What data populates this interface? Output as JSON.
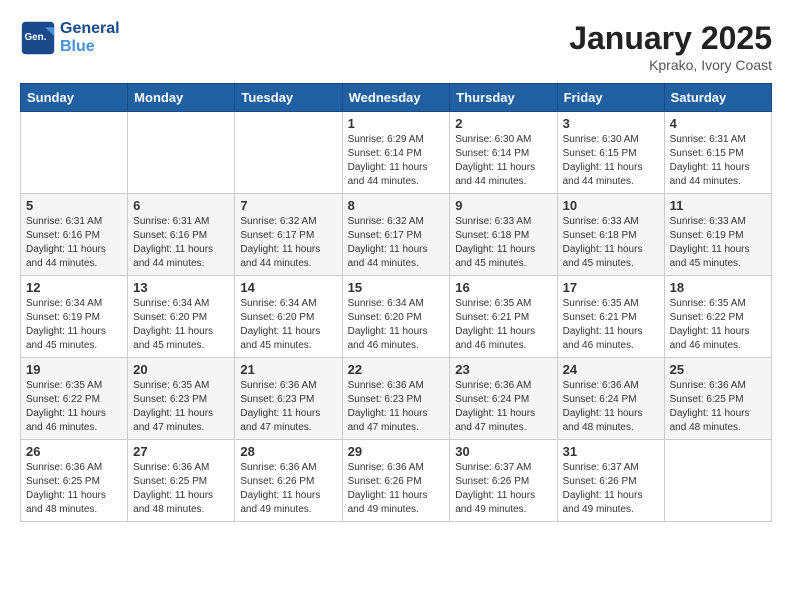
{
  "header": {
    "logo_line1": "General",
    "logo_line2": "Blue",
    "month": "January 2025",
    "location": "Kprako, Ivory Coast"
  },
  "weekdays": [
    "Sunday",
    "Monday",
    "Tuesday",
    "Wednesday",
    "Thursday",
    "Friday",
    "Saturday"
  ],
  "weeks": [
    [
      {
        "day": "",
        "sunrise": "",
        "sunset": "",
        "daylight": ""
      },
      {
        "day": "",
        "sunrise": "",
        "sunset": "",
        "daylight": ""
      },
      {
        "day": "",
        "sunrise": "",
        "sunset": "",
        "daylight": ""
      },
      {
        "day": "1",
        "sunrise": "Sunrise: 6:29 AM",
        "sunset": "Sunset: 6:14 PM",
        "daylight": "Daylight: 11 hours and 44 minutes."
      },
      {
        "day": "2",
        "sunrise": "Sunrise: 6:30 AM",
        "sunset": "Sunset: 6:14 PM",
        "daylight": "Daylight: 11 hours and 44 minutes."
      },
      {
        "day": "3",
        "sunrise": "Sunrise: 6:30 AM",
        "sunset": "Sunset: 6:15 PM",
        "daylight": "Daylight: 11 hours and 44 minutes."
      },
      {
        "day": "4",
        "sunrise": "Sunrise: 6:31 AM",
        "sunset": "Sunset: 6:15 PM",
        "daylight": "Daylight: 11 hours and 44 minutes."
      }
    ],
    [
      {
        "day": "5",
        "sunrise": "Sunrise: 6:31 AM",
        "sunset": "Sunset: 6:16 PM",
        "daylight": "Daylight: 11 hours and 44 minutes."
      },
      {
        "day": "6",
        "sunrise": "Sunrise: 6:31 AM",
        "sunset": "Sunset: 6:16 PM",
        "daylight": "Daylight: 11 hours and 44 minutes."
      },
      {
        "day": "7",
        "sunrise": "Sunrise: 6:32 AM",
        "sunset": "Sunset: 6:17 PM",
        "daylight": "Daylight: 11 hours and 44 minutes."
      },
      {
        "day": "8",
        "sunrise": "Sunrise: 6:32 AM",
        "sunset": "Sunset: 6:17 PM",
        "daylight": "Daylight: 11 hours and 44 minutes."
      },
      {
        "day": "9",
        "sunrise": "Sunrise: 6:33 AM",
        "sunset": "Sunset: 6:18 PM",
        "daylight": "Daylight: 11 hours and 45 minutes."
      },
      {
        "day": "10",
        "sunrise": "Sunrise: 6:33 AM",
        "sunset": "Sunset: 6:18 PM",
        "daylight": "Daylight: 11 hours and 45 minutes."
      },
      {
        "day": "11",
        "sunrise": "Sunrise: 6:33 AM",
        "sunset": "Sunset: 6:19 PM",
        "daylight": "Daylight: 11 hours and 45 minutes."
      }
    ],
    [
      {
        "day": "12",
        "sunrise": "Sunrise: 6:34 AM",
        "sunset": "Sunset: 6:19 PM",
        "daylight": "Daylight: 11 hours and 45 minutes."
      },
      {
        "day": "13",
        "sunrise": "Sunrise: 6:34 AM",
        "sunset": "Sunset: 6:20 PM",
        "daylight": "Daylight: 11 hours and 45 minutes."
      },
      {
        "day": "14",
        "sunrise": "Sunrise: 6:34 AM",
        "sunset": "Sunset: 6:20 PM",
        "daylight": "Daylight: 11 hours and 45 minutes."
      },
      {
        "day": "15",
        "sunrise": "Sunrise: 6:34 AM",
        "sunset": "Sunset: 6:20 PM",
        "daylight": "Daylight: 11 hours and 46 minutes."
      },
      {
        "day": "16",
        "sunrise": "Sunrise: 6:35 AM",
        "sunset": "Sunset: 6:21 PM",
        "daylight": "Daylight: 11 hours and 46 minutes."
      },
      {
        "day": "17",
        "sunrise": "Sunrise: 6:35 AM",
        "sunset": "Sunset: 6:21 PM",
        "daylight": "Daylight: 11 hours and 46 minutes."
      },
      {
        "day": "18",
        "sunrise": "Sunrise: 6:35 AM",
        "sunset": "Sunset: 6:22 PM",
        "daylight": "Daylight: 11 hours and 46 minutes."
      }
    ],
    [
      {
        "day": "19",
        "sunrise": "Sunrise: 6:35 AM",
        "sunset": "Sunset: 6:22 PM",
        "daylight": "Daylight: 11 hours and 46 minutes."
      },
      {
        "day": "20",
        "sunrise": "Sunrise: 6:35 AM",
        "sunset": "Sunset: 6:23 PM",
        "daylight": "Daylight: 11 hours and 47 minutes."
      },
      {
        "day": "21",
        "sunrise": "Sunrise: 6:36 AM",
        "sunset": "Sunset: 6:23 PM",
        "daylight": "Daylight: 11 hours and 47 minutes."
      },
      {
        "day": "22",
        "sunrise": "Sunrise: 6:36 AM",
        "sunset": "Sunset: 6:23 PM",
        "daylight": "Daylight: 11 hours and 47 minutes."
      },
      {
        "day": "23",
        "sunrise": "Sunrise: 6:36 AM",
        "sunset": "Sunset: 6:24 PM",
        "daylight": "Daylight: 11 hours and 47 minutes."
      },
      {
        "day": "24",
        "sunrise": "Sunrise: 6:36 AM",
        "sunset": "Sunset: 6:24 PM",
        "daylight": "Daylight: 11 hours and 48 minutes."
      },
      {
        "day": "25",
        "sunrise": "Sunrise: 6:36 AM",
        "sunset": "Sunset: 6:25 PM",
        "daylight": "Daylight: 11 hours and 48 minutes."
      }
    ],
    [
      {
        "day": "26",
        "sunrise": "Sunrise: 6:36 AM",
        "sunset": "Sunset: 6:25 PM",
        "daylight": "Daylight: 11 hours and 48 minutes."
      },
      {
        "day": "27",
        "sunrise": "Sunrise: 6:36 AM",
        "sunset": "Sunset: 6:25 PM",
        "daylight": "Daylight: 11 hours and 48 minutes."
      },
      {
        "day": "28",
        "sunrise": "Sunrise: 6:36 AM",
        "sunset": "Sunset: 6:26 PM",
        "daylight": "Daylight: 11 hours and 49 minutes."
      },
      {
        "day": "29",
        "sunrise": "Sunrise: 6:36 AM",
        "sunset": "Sunset: 6:26 PM",
        "daylight": "Daylight: 11 hours and 49 minutes."
      },
      {
        "day": "30",
        "sunrise": "Sunrise: 6:37 AM",
        "sunset": "Sunset: 6:26 PM",
        "daylight": "Daylight: 11 hours and 49 minutes."
      },
      {
        "day": "31",
        "sunrise": "Sunrise: 6:37 AM",
        "sunset": "Sunset: 6:26 PM",
        "daylight": "Daylight: 11 hours and 49 minutes."
      },
      {
        "day": "",
        "sunrise": "",
        "sunset": "",
        "daylight": ""
      }
    ]
  ]
}
